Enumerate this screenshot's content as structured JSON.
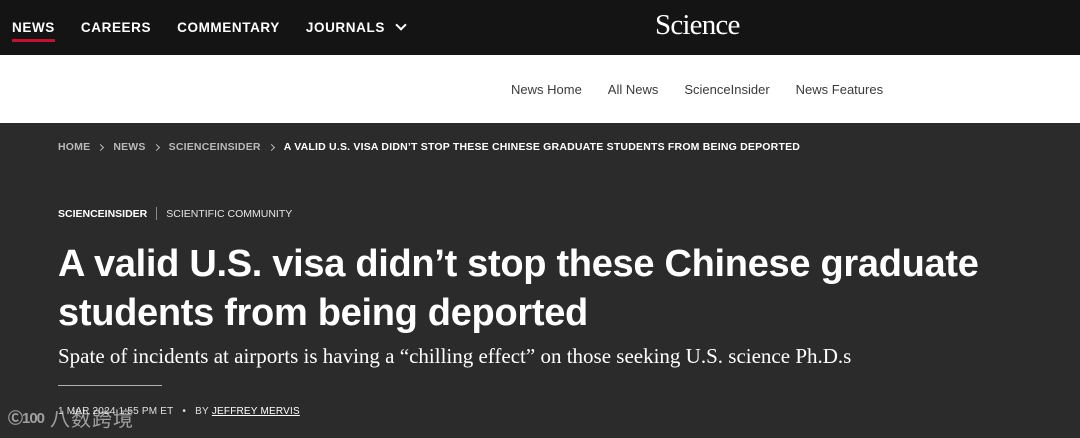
{
  "topnav": {
    "items": [
      {
        "label": "NEWS",
        "active": true
      },
      {
        "label": "CAREERS"
      },
      {
        "label": "COMMENTARY"
      },
      {
        "label": "JOURNALS"
      }
    ],
    "logo": "Science"
  },
  "subnav": {
    "links": [
      "News Home",
      "All News",
      "ScienceInsider",
      "News Features"
    ]
  },
  "breadcrumb": {
    "items": [
      "HOME",
      "NEWS",
      "SCIENCEINSIDER"
    ],
    "current": "A VALID U.S. VISA DIDN’T STOP THESE CHINESE GRADUATE STUDENTS FROM BEING DEPORTED"
  },
  "tags": {
    "primary": "SCIENCEINSIDER",
    "secondary": "SCIENTIFIC COMMUNITY"
  },
  "article": {
    "headline_line1": "A valid U.S. visa didn’t stop these Chinese graduate",
    "headline_line2": "students from being deported",
    "dek": "Spate of incidents at airports is having a “chilling effect” on those seeking U.S. science Ph.D.s",
    "date": "1 MAR 2024",
    "time": "1:55 PM ET",
    "dot": "•",
    "by": "BY",
    "author": "JEFFREY MERVIS"
  },
  "watermark": {
    "logo": "Ⓒ100",
    "text": "八数跨境"
  },
  "colors": {
    "accent": "#c8102e",
    "topbar": "#141414",
    "hero": "#2b2b2b"
  }
}
